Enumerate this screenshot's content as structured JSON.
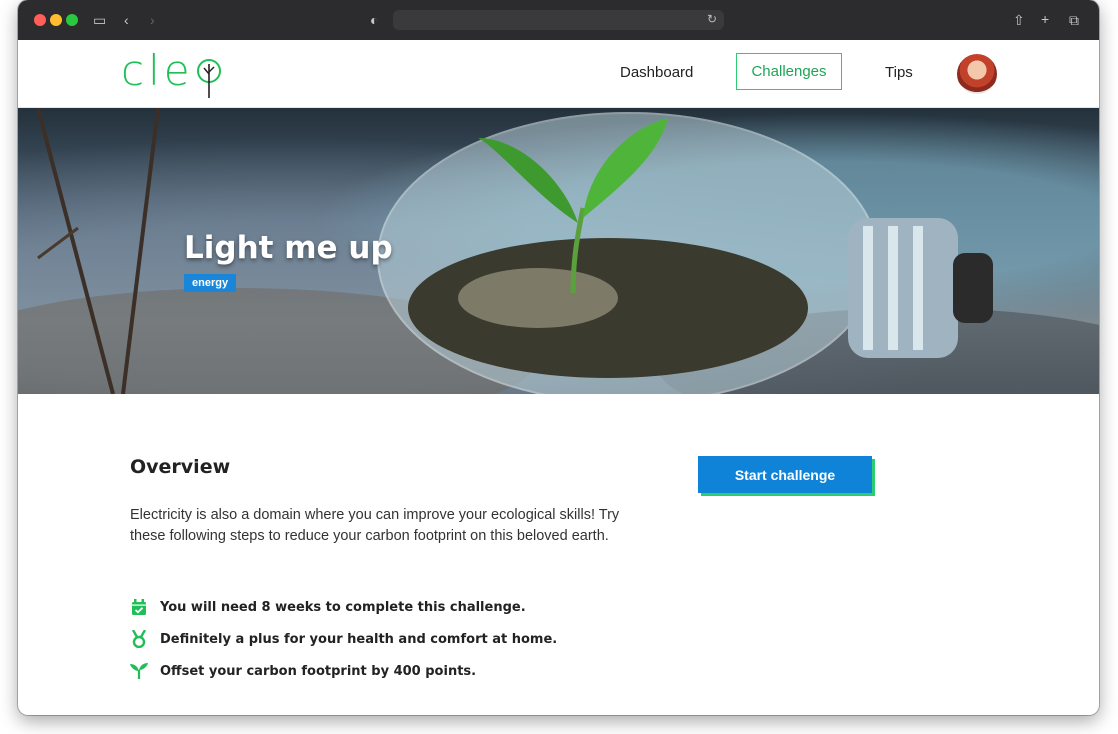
{
  "browser": {
    "reload_icon": "↻"
  },
  "nav": {
    "logo_text": "cle",
    "links": [
      "Dashboard",
      "Challenges",
      "Tips"
    ],
    "active": "Challenges",
    "accent_color": "#2ecc71"
  },
  "hero": {
    "title": "Light me up",
    "tag": "energy"
  },
  "main": {
    "overview_title": "Overview",
    "description": "Electricity is also a domain where you can improve your ecological skills! Try these following steps to reduce your carbon footprint on this beloved earth.",
    "start_button": "Start challenge",
    "items": [
      {
        "icon": "calendar-check-icon",
        "text": "You will need 8 weeks to complete this challenge."
      },
      {
        "icon": "medal-icon",
        "text": "Definitely a plus for your health and comfort at home."
      },
      {
        "icon": "sprout-icon",
        "text": "Offset your carbon footprint by 400 points."
      }
    ]
  }
}
